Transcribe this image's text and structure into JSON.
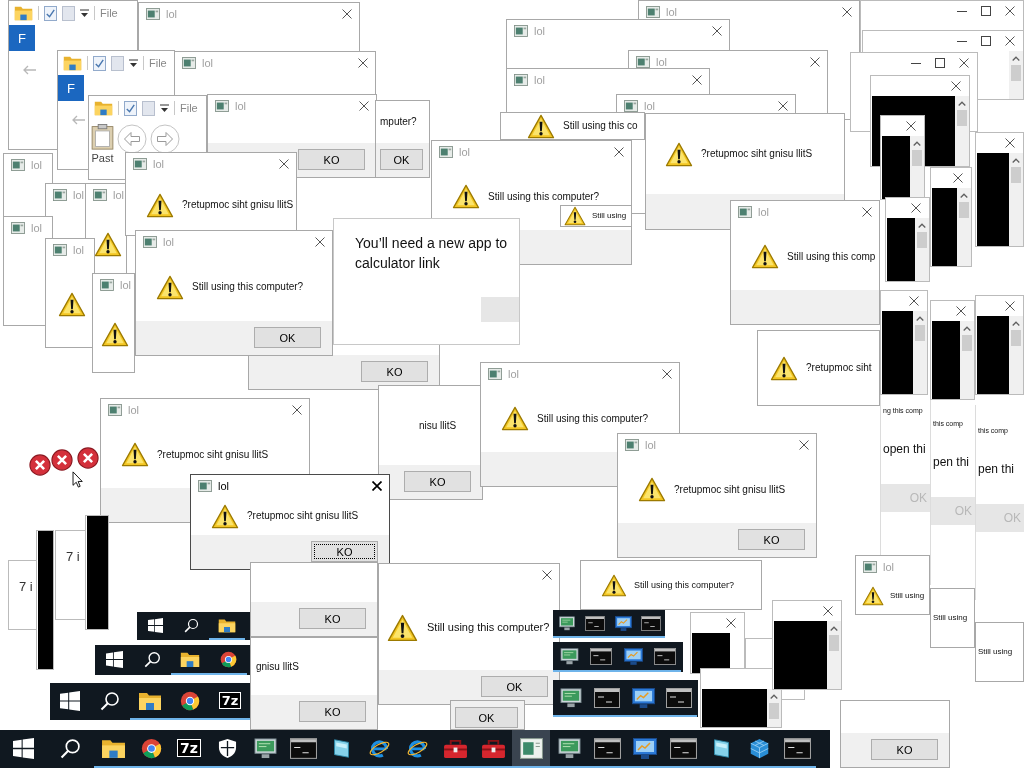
{
  "windows": [
    {
      "kind": "explorer",
      "menu": "File",
      "tab": "F"
    },
    {
      "kind": "editor"
    },
    {
      "kind": "dialog",
      "title": "lol",
      "active": false
    },
    {
      "kind": "dialog",
      "title": "lol",
      "active": false
    },
    {
      "kind": "dialog",
      "title": "lol",
      "active": false
    },
    {
      "kind": "explorer",
      "menu": "File",
      "tab": "F"
    },
    {
      "kind": "dialog",
      "title": "lol",
      "active": false
    },
    {
      "kind": "dialog",
      "title": "lol",
      "active": false
    },
    {
      "kind": "dialog",
      "title": "lol",
      "active": false
    },
    {
      "kind": "editor"
    },
    {
      "kind": "explorer",
      "menu": "File",
      "paste": "Past"
    },
    {
      "kind": "dialog",
      "title": "lol",
      "active": false,
      "button": {
        "label": "KO",
        "disabled": false,
        "focused": false
      }
    },
    {
      "kind": "dialog_part",
      "message": "mputer?",
      "button": {
        "label": "OK",
        "disabled": false,
        "focused": false
      }
    },
    {
      "kind": "dialog",
      "title": "lol",
      "active": false
    },
    {
      "kind": "dialog_part",
      "message": "Still using this co"
    },
    {
      "kind": "dialog",
      "title": "lol",
      "active": false,
      "message": "Still using this computer?"
    },
    {
      "kind": "dialog_part",
      "message": "?retupmoc siht gnisu llitS"
    },
    {
      "kind": "dialog_part",
      "message": "Still using"
    },
    {
      "kind": "dialog",
      "title": "lol",
      "active": false
    },
    {
      "kind": "dialog",
      "title": "lol",
      "active": false
    },
    {
      "kind": "dialog",
      "title": "lol",
      "active": false
    },
    {
      "kind": "dialog",
      "title": "lol",
      "active": false
    },
    {
      "kind": "dialog",
      "title": "lol",
      "active": false
    },
    {
      "kind": "dialog",
      "title": "lol",
      "active": false
    },
    {
      "kind": "dialog",
      "title": "lol",
      "active": false,
      "message": "?retupmoc siht gnisu llitS"
    },
    {
      "kind": "dialog",
      "title": "lol",
      "active": false,
      "message": "Still using this comp"
    },
    {
      "kind": "dialog_part",
      "button": {
        "label": "KO",
        "disabled": false,
        "focused": false
      }
    },
    {
      "kind": "dialog",
      "title": "lol",
      "active": false,
      "message": "Still using this computer?",
      "button": {
        "label": "OK",
        "disabled": false,
        "focused": false
      }
    },
    {
      "kind": "app_prompt",
      "line_1": "You’ll need a new app to",
      "line_2": "calculator link"
    },
    {
      "kind": "console"
    },
    {
      "kind": "console"
    },
    {
      "kind": "console"
    },
    {
      "kind": "console"
    },
    {
      "kind": "console"
    },
    {
      "kind": "console"
    },
    {
      "kind": "console"
    },
    {
      "kind": "console"
    },
    {
      "kind": "console"
    },
    {
      "kind": "console"
    },
    {
      "kind": "console"
    },
    {
      "kind": "prompt_part",
      "caption": "ng this comp",
      "text": "open thi",
      "button": {
        "label": "OK",
        "disabled": true,
        "focused": false
      }
    },
    {
      "kind": "prompt_part",
      "caption": "this comp",
      "text": "pen thi",
      "button": {
        "label": "OK",
        "disabled": true,
        "focused": false
      }
    },
    {
      "kind": "prompt_part",
      "caption": "this comp",
      "text": "pen thi",
      "button": {
        "label": "OK",
        "disabled": true,
        "focused": false
      }
    },
    {
      "kind": "dialog",
      "title": "lol",
      "active": false,
      "message": "Still using"
    },
    {
      "kind": "dialog_part",
      "message": "Still using"
    },
    {
      "kind": "dialog_part",
      "message": "Still using"
    },
    {
      "kind": "dialog",
      "title": "lol",
      "active": false,
      "message": "?retupmoc siht gnisu llitS"
    },
    {
      "kind": "note",
      "text": "7 i"
    },
    {
      "kind": "note",
      "text": "7 i"
    },
    {
      "kind": "console"
    },
    {
      "kind": "console"
    },
    {
      "kind": "dialog_part",
      "message": "?retupmoc siht"
    },
    {
      "kind": "dialog_part",
      "message": "nisu llitS",
      "button": {
        "label": "KO",
        "disabled": false,
        "focused": false
      }
    },
    {
      "kind": "dialog",
      "title": "lol",
      "active": false,
      "message": "Still using this computer?"
    },
    {
      "kind": "dialog",
      "title": "lol",
      "active": true,
      "message": "?retupmoc siht gnisu llitS",
      "button": {
        "label": "KO",
        "disabled": false,
        "focused": true
      }
    },
    {
      "kind": "dialog",
      "title": "lol",
      "active": false,
      "message": "?retupmoc siht gnisu llitS",
      "button": {
        "label": "KO",
        "disabled": false,
        "focused": false
      }
    },
    {
      "kind": "dialog_part",
      "message": "Still using this computer?"
    },
    {
      "kind": "dialog_part",
      "button": {
        "label": "KO",
        "disabled": false,
        "focused": false
      }
    },
    {
      "kind": "dialog_part",
      "message": "gnisu llitS",
      "button": {
        "label": "KO",
        "disabled": false,
        "focused": false
      }
    },
    {
      "kind": "dialog",
      "active": false,
      "message": "Still using this computer?",
      "button": {
        "label": "OK",
        "disabled": false,
        "focused": false
      }
    },
    {
      "kind": "dialog_part",
      "button": {
        "label": "OK",
        "disabled": false,
        "focused": false
      }
    },
    {
      "kind": "taskbar_strip",
      "items": [
        {
          "kind": "start",
          "running": false,
          "active": false
        },
        {
          "kind": "search",
          "running": false,
          "active": false
        },
        {
          "kind": "explorer",
          "running": true,
          "active": false
        }
      ]
    },
    {
      "kind": "taskbar_strip",
      "items": [
        {
          "kind": "start",
          "running": false,
          "active": false
        },
        {
          "kind": "search",
          "running": false,
          "active": false
        },
        {
          "kind": "explorer",
          "running": true,
          "active": false
        },
        {
          "kind": "chrome",
          "running": true,
          "active": false
        }
      ]
    },
    {
      "kind": "taskbar_strip",
      "items": [
        {
          "kind": "start",
          "running": false,
          "active": false
        },
        {
          "kind": "search",
          "running": false,
          "active": false
        },
        {
          "kind": "explorer",
          "running": true,
          "active": false
        },
        {
          "kind": "chrome",
          "running": true,
          "active": false
        },
        {
          "kind": "archiver",
          "label": "7z",
          "running": true,
          "active": false
        }
      ]
    },
    {
      "kind": "taskbar_strip",
      "items": [
        {
          "kind": "computer",
          "running": true,
          "active": false
        },
        {
          "kind": "cmd",
          "running": true,
          "active": false
        },
        {
          "kind": "control",
          "running": true,
          "active": false
        },
        {
          "kind": "cmd",
          "running": true,
          "active": false
        }
      ]
    },
    {
      "kind": "taskbar_strip",
      "items": [
        {
          "kind": "computer",
          "running": true,
          "active": false
        },
        {
          "kind": "cmd",
          "running": true,
          "active": false
        },
        {
          "kind": "control",
          "running": true,
          "active": false
        },
        {
          "kind": "cmd",
          "running": true,
          "active": false
        }
      ]
    },
    {
      "kind": "taskbar_strip",
      "items": [
        {
          "kind": "computer",
          "running": true,
          "active": false
        },
        {
          "kind": "cmd",
          "running": true,
          "active": false
        },
        {
          "kind": "control",
          "running": true,
          "active": false
        },
        {
          "kind": "cmd",
          "running": true,
          "active": false
        }
      ]
    },
    {
      "kind": "console"
    },
    {
      "kind": "console"
    },
    {
      "kind": "console"
    },
    {
      "kind": "console"
    },
    {
      "kind": "taskbar",
      "items": [
        {
          "kind": "start",
          "running": false,
          "active": false
        },
        {
          "kind": "search",
          "running": false,
          "active": false
        },
        {
          "kind": "explorer",
          "running": true,
          "active": false
        },
        {
          "kind": "chrome",
          "running": true,
          "active": false
        },
        {
          "kind": "archiver",
          "label": "7z",
          "running": true,
          "active": false
        },
        {
          "kind": "shield",
          "running": true,
          "active": false
        },
        {
          "kind": "computer",
          "running": true,
          "active": false
        },
        {
          "kind": "cmd",
          "running": true,
          "active": false
        },
        {
          "kind": "tile",
          "running": true,
          "active": false
        },
        {
          "kind": "ie",
          "running": true,
          "active": false
        },
        {
          "kind": "ie",
          "running": true,
          "active": false
        },
        {
          "kind": "toolbox",
          "running": true,
          "active": false
        },
        {
          "kind": "toolbox",
          "running": true,
          "active": false
        },
        {
          "kind": "app",
          "running": true,
          "active": true
        },
        {
          "kind": "computer",
          "running": true,
          "active": false
        },
        {
          "kind": "cmd",
          "running": true,
          "active": false
        },
        {
          "kind": "control",
          "running": true,
          "active": false
        },
        {
          "kind": "cmd",
          "running": true,
          "active": false
        },
        {
          "kind": "tile",
          "running": true,
          "active": false
        },
        {
          "kind": "cube",
          "running": true,
          "active": false
        },
        {
          "kind": "cmd",
          "running": true,
          "active": false
        }
      ]
    },
    {
      "kind": "dialog_part",
      "button": {
        "label": "KO",
        "disabled": false,
        "focused": false
      }
    }
  ],
  "overlay_icons": [
    {
      "kind": "error"
    },
    {
      "kind": "error"
    },
    {
      "kind": "error"
    },
    {
      "kind": "cursor"
    }
  ]
}
